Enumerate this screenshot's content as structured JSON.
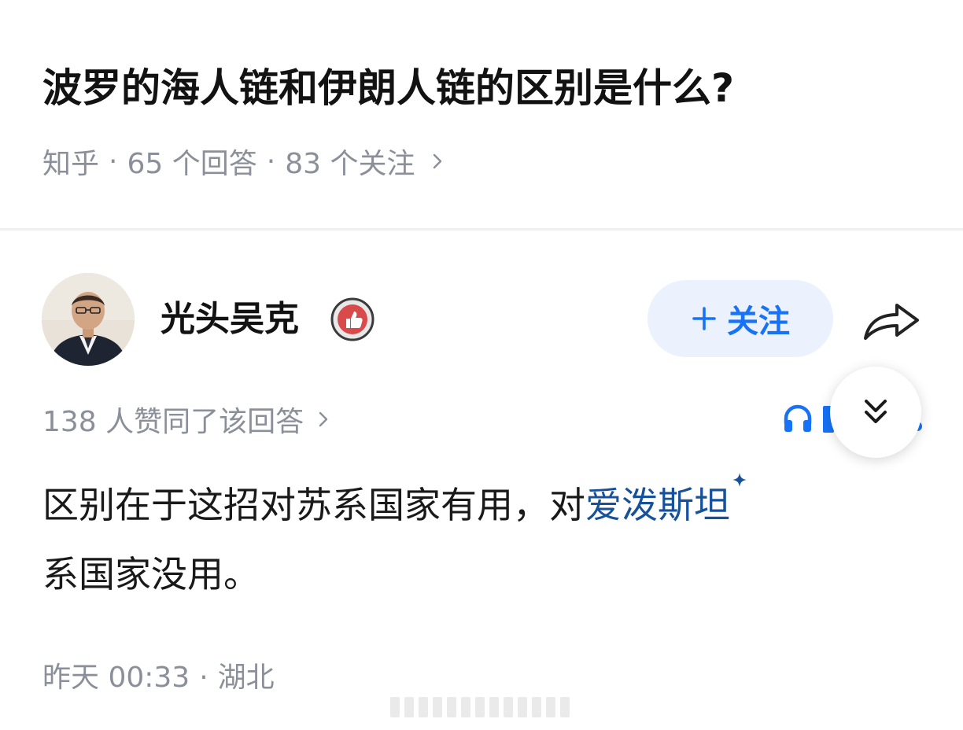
{
  "question": {
    "title": "波罗的海人链和伊朗人链的区别是什么?",
    "source": "知乎",
    "separator": "·",
    "answers_count": "65 个回答",
    "followers_count": "83 个关注"
  },
  "author": {
    "name": "光头吴克",
    "badge_icon": "thumbs-up-badge-icon"
  },
  "actions": {
    "follow_label": "关注",
    "follow_icon": "plus-icon",
    "share_icon": "share-arrow-icon",
    "collapse_icon": "double-chevron-down-icon",
    "listen_icon": "headphones-icon"
  },
  "answer": {
    "votes_text": "138 人赞同了该回答",
    "body_line1_prefix": "区别在于这招对苏系国家有用，对",
    "keyword": "爱泼斯坦",
    "body_line2": "系国家没用。",
    "time": "昨天 00:33",
    "dot": "·",
    "location": "湖北"
  },
  "colors": {
    "accent": "#1772f6",
    "link": "#175199",
    "meta": "#8a8f99",
    "follow_bg": "#ebf2fe"
  }
}
